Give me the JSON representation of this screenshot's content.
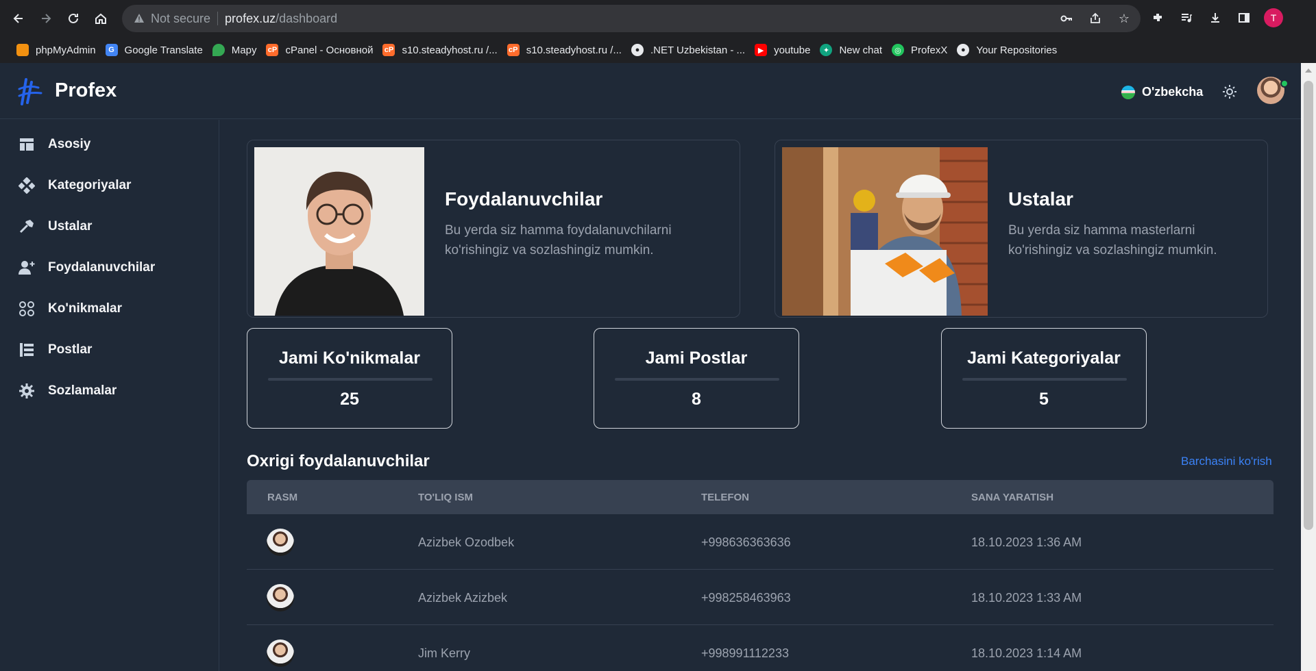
{
  "browser": {
    "address_secure": "Not secure",
    "address_host": "profex.uz",
    "address_path": "/dashboard",
    "profile_letter": "T",
    "bookmarks": [
      {
        "label": "phpMyAdmin",
        "color": "#f29111"
      },
      {
        "label": "Google Translate",
        "color": "#4285f4"
      },
      {
        "label": "Mapy",
        "color": "#34a853"
      },
      {
        "label": "cPanel - Основной",
        "color": "#ff6c2c"
      },
      {
        "label": "s10.steadyhost.ru /...",
        "color": "#ff6c2c"
      },
      {
        "label": "s10.steadyhost.ru /...",
        "color": "#ff6c2c"
      },
      {
        "label": ".NET Uzbekistan - ...",
        "color": "#e8eaed"
      },
      {
        "label": "youtube",
        "color": "#ff0000"
      },
      {
        "label": "New chat",
        "color": "#10a37f"
      },
      {
        "label": "ProfexX",
        "color": "#22c55e"
      },
      {
        "label": "Your Repositories",
        "color": "#e8eaed"
      }
    ]
  },
  "header": {
    "brand": "Profex",
    "language": "O'zbekcha"
  },
  "sidebar": {
    "items": [
      {
        "label": "Asosiy",
        "icon": "layout-icon"
      },
      {
        "label": "Kategoriyalar",
        "icon": "categories-icon"
      },
      {
        "label": "Ustalar",
        "icon": "hammer-icon"
      },
      {
        "label": "Foydalanuvchilar",
        "icon": "user-add-icon"
      },
      {
        "label": "Ko'nikmalar",
        "icon": "skills-icon"
      },
      {
        "label": "Postlar",
        "icon": "list-icon"
      },
      {
        "label": "Sozlamalar",
        "icon": "gear-icon"
      }
    ]
  },
  "cards": {
    "users": {
      "title": "Foydalanuvchilar",
      "description": "Bu yerda siz hamma foydalanuvchilarni ko'rishingiz va sozlashingiz mumkin."
    },
    "masters": {
      "title": "Ustalar",
      "description": "Bu yerda siz hamma masterlarni ko'rishingiz va sozlashingiz mumkin."
    }
  },
  "stats": {
    "skills": {
      "title": "Jami Ko'nikmalar",
      "value": "25"
    },
    "posts": {
      "title": "Jami Postlar",
      "value": "8"
    },
    "categories": {
      "title": "Jami Kategoriyalar",
      "value": "5"
    }
  },
  "recent_users": {
    "title": "Oxrigi foydalanuvchilar",
    "see_all": "Barchasini ko'rish",
    "columns": [
      "Rasm",
      "To'liq ism",
      "Telefon",
      "Sana yaratish"
    ],
    "rows": [
      {
        "name": "Azizbek Ozodbek",
        "phone": "+998636363636",
        "created": "18.10.2023 1:36 AM"
      },
      {
        "name": "Azizbek Azizbek",
        "phone": "+998258463963",
        "created": "18.10.2023 1:33 AM"
      },
      {
        "name": "Jim Kerry",
        "phone": "+998991112233",
        "created": "18.10.2023 1:14 AM"
      }
    ]
  },
  "colors": {
    "background": "#1f2937",
    "accent": "#3b82f6",
    "online": "#22c55e"
  }
}
